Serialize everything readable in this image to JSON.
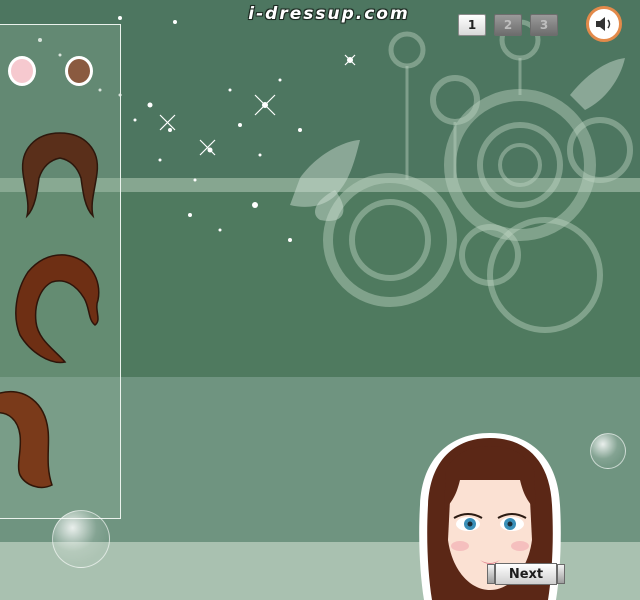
{
  "site": {
    "logo_text": "i-dressup.com"
  },
  "pagination": {
    "pages": [
      {
        "label": "1",
        "active": true
      },
      {
        "label": "2",
        "active": false
      },
      {
        "label": "3",
        "active": false
      }
    ]
  },
  "sound": {
    "icon": "speaker-icon"
  },
  "palette": {
    "swatches": [
      {
        "color": "#f6c9cf",
        "border": "#ffffff"
      },
      {
        "color": "#8a5a40",
        "border": "#ffffff"
      }
    ]
  },
  "hair_options": [
    {
      "name": "short-wavy-hair",
      "color": "#5a2f1a"
    },
    {
      "name": "long-curly-hair",
      "color": "#6e2f14"
    },
    {
      "name": "bob-hair",
      "color": "#7a3a1a"
    }
  ],
  "controls": {
    "next_label": "Next"
  },
  "colors": {
    "accent_orange": "#e38a4a",
    "background_green": "#4f7a5f"
  }
}
